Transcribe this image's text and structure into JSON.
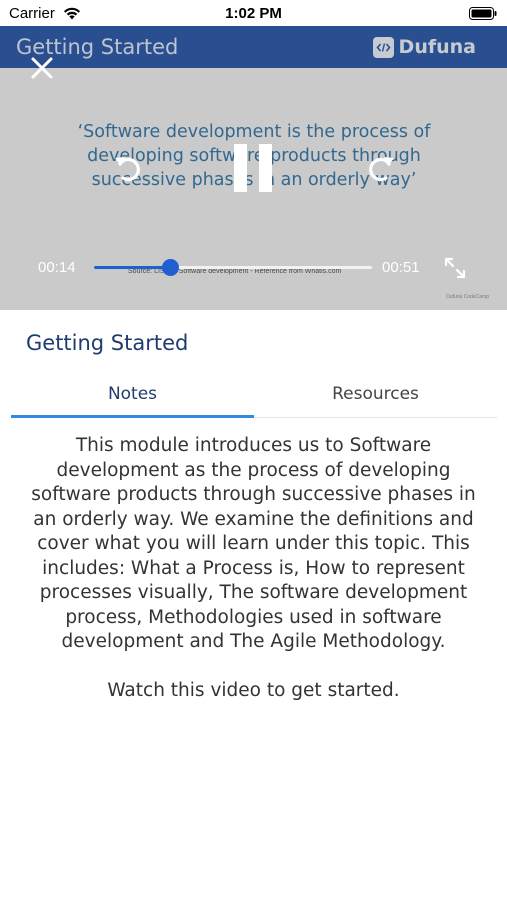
{
  "status_bar": {
    "carrier": "Carrier",
    "time": "1:02 PM",
    "wifi_icon": "wifi-icon",
    "battery_icon": "battery-icon"
  },
  "video": {
    "title": "Getting Started",
    "brand": "Dufuna",
    "slide_quote": "‘Software development is the process of developing software products through successive phases in an orderly way’",
    "slide_source": "Source: LIST IT Software development - Reference from Whatis.com",
    "slide_watermark": "Dufuna CodeCamp",
    "current_time": "00:14",
    "total_time": "00:51",
    "progress": 0.275,
    "controls": {
      "close": "close-icon",
      "rewind": "rewind-icon",
      "pause": "pause-icon",
      "forward": "forward-icon",
      "fullscreen": "fullscreen-icon"
    }
  },
  "lesson": {
    "title": "Getting Started",
    "tabs": [
      {
        "label": "Notes",
        "active": true
      },
      {
        "label": "Resources",
        "active": false
      }
    ],
    "notes": "This module introduces us to Software development as the process of developing software products through successive phases in an orderly way. We examine the definitions and cover what you will learn under this topic. This includes: What a Process is, How to represent processes visually, The software development process, Methodologies used in software development and The Agile Methodology.",
    "cta": "Watch this video to get started."
  },
  "colors": {
    "header_blue": "#1f4fa3",
    "accent_blue": "#1f5fd1",
    "tab_underline": "#2f8ae6",
    "title_navy": "#1f3c6e",
    "quote_blue": "#2a6fa1"
  }
}
